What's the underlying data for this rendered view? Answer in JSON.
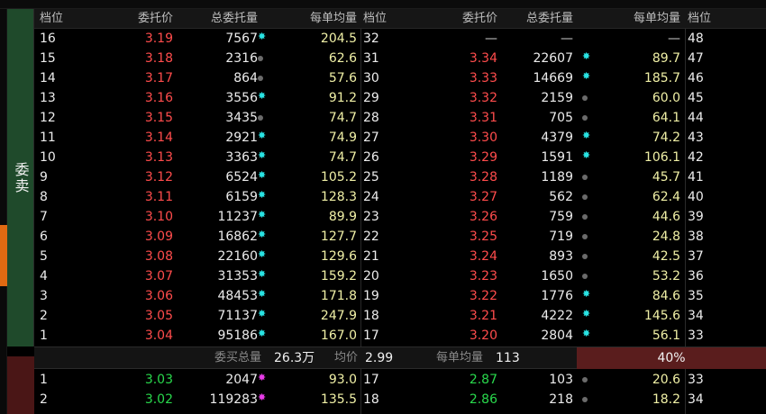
{
  "side": {
    "sell_label": "委卖"
  },
  "headers": [
    "档位",
    "委托价",
    "总委托量",
    "每单均量",
    "档位",
    "委托价",
    "总委托量",
    "每单均量",
    "档位"
  ],
  "sell_rows": [
    {
      "l": {
        "lv": "16",
        "px": "3.19",
        "vol": "7567",
        "m": "star",
        "avg": "204.5"
      },
      "r": {
        "lv": "32",
        "px": "—",
        "vol": "—",
        "m": "none",
        "avg": "—"
      },
      "e": "48"
    },
    {
      "l": {
        "lv": "15",
        "px": "3.18",
        "vol": "2316",
        "m": "dot",
        "avg": "62.6"
      },
      "r": {
        "lv": "31",
        "px": "3.34",
        "vol": "22607",
        "m": "star",
        "avg": "89.7"
      },
      "e": "47"
    },
    {
      "l": {
        "lv": "14",
        "px": "3.17",
        "vol": "864",
        "m": "dot",
        "avg": "57.6"
      },
      "r": {
        "lv": "30",
        "px": "3.33",
        "vol": "14669",
        "m": "star",
        "avg": "185.7"
      },
      "e": "46"
    },
    {
      "l": {
        "lv": "13",
        "px": "3.16",
        "vol": "3556",
        "m": "star",
        "avg": "91.2"
      },
      "r": {
        "lv": "29",
        "px": "3.32",
        "vol": "2159",
        "m": "dot",
        "avg": "60.0"
      },
      "e": "45"
    },
    {
      "l": {
        "lv": "12",
        "px": "3.15",
        "vol": "3435",
        "m": "dot",
        "avg": "74.7"
      },
      "r": {
        "lv": "28",
        "px": "3.31",
        "vol": "705",
        "m": "dot",
        "avg": "64.1"
      },
      "e": "44"
    },
    {
      "l": {
        "lv": "11",
        "px": "3.14",
        "vol": "2921",
        "m": "star",
        "avg": "74.9"
      },
      "r": {
        "lv": "27",
        "px": "3.30",
        "vol": "4379",
        "m": "star",
        "avg": "74.2"
      },
      "e": "43"
    },
    {
      "l": {
        "lv": "10",
        "px": "3.13",
        "vol": "3363",
        "m": "star",
        "avg": "74.7"
      },
      "r": {
        "lv": "26",
        "px": "3.29",
        "vol": "1591",
        "m": "star",
        "avg": "106.1"
      },
      "e": "42"
    },
    {
      "l": {
        "lv": "9",
        "px": "3.12",
        "vol": "6524",
        "m": "star",
        "avg": "105.2"
      },
      "r": {
        "lv": "25",
        "px": "3.28",
        "vol": "1189",
        "m": "dot",
        "avg": "45.7"
      },
      "e": "41"
    },
    {
      "l": {
        "lv": "8",
        "px": "3.11",
        "vol": "6159",
        "m": "star",
        "avg": "128.3"
      },
      "r": {
        "lv": "24",
        "px": "3.27",
        "vol": "562",
        "m": "dot",
        "avg": "62.4"
      },
      "e": "40"
    },
    {
      "l": {
        "lv": "7",
        "px": "3.10",
        "vol": "11237",
        "m": "star",
        "avg": "89.9"
      },
      "r": {
        "lv": "23",
        "px": "3.26",
        "vol": "759",
        "m": "dot",
        "avg": "44.6"
      },
      "e": "39"
    },
    {
      "l": {
        "lv": "6",
        "px": "3.09",
        "vol": "16862",
        "m": "star",
        "avg": "127.7"
      },
      "r": {
        "lv": "22",
        "px": "3.25",
        "vol": "719",
        "m": "dot",
        "avg": "24.8"
      },
      "e": "38"
    },
    {
      "l": {
        "lv": "5",
        "px": "3.08",
        "vol": "22160",
        "m": "star",
        "avg": "129.6"
      },
      "r": {
        "lv": "21",
        "px": "3.24",
        "vol": "893",
        "m": "dot",
        "avg": "42.5"
      },
      "e": "37"
    },
    {
      "l": {
        "lv": "4",
        "px": "3.07",
        "vol": "31353",
        "m": "star",
        "avg": "159.2"
      },
      "r": {
        "lv": "20",
        "px": "3.23",
        "vol": "1650",
        "m": "dot",
        "avg": "53.2"
      },
      "e": "36"
    },
    {
      "l": {
        "lv": "3",
        "px": "3.06",
        "vol": "48453",
        "m": "star",
        "avg": "171.8"
      },
      "r": {
        "lv": "19",
        "px": "3.22",
        "vol": "1776",
        "m": "star",
        "avg": "84.6"
      },
      "e": "35"
    },
    {
      "l": {
        "lv": "2",
        "px": "3.05",
        "vol": "71137",
        "m": "star",
        "avg": "247.9"
      },
      "r": {
        "lv": "18",
        "px": "3.21",
        "vol": "4222",
        "m": "star",
        "avg": "145.6"
      },
      "e": "34"
    },
    {
      "l": {
        "lv": "1",
        "px": "3.04",
        "vol": "95186",
        "m": "star",
        "avg": "167.0"
      },
      "r": {
        "lv": "17",
        "px": "3.20",
        "vol": "2804",
        "m": "star",
        "avg": "56.1"
      },
      "e": "33"
    }
  ],
  "summary": {
    "total_label": "委买总量",
    "total_value": "26.3万",
    "avg_price_label": "均价",
    "avg_price_value": "2.99",
    "avg_vol_label": "每单均量",
    "avg_vol_value": "113",
    "ratio": "40%"
  },
  "buy_rows": [
    {
      "l": {
        "lv": "1",
        "px": "3.03",
        "vol": "2047",
        "m": "magenta",
        "avg": "93.0"
      },
      "r": {
        "lv": "17",
        "px": "2.87",
        "vol": "103",
        "m": "dot",
        "avg": "20.6"
      },
      "e": "33"
    },
    {
      "l": {
        "lv": "2",
        "px": "3.02",
        "vol": "119283",
        "m": "magenta",
        "avg": "135.5"
      },
      "r": {
        "lv": "18",
        "px": "2.86",
        "vol": "218",
        "m": "dot",
        "avg": "18.2"
      },
      "e": "34"
    }
  ],
  "colors": {
    "sell_price": "#ff4c4c",
    "buy_price": "#29d84c",
    "avg": "#f0f0a6",
    "star_marker": "#29e3e3",
    "magenta_marker": "#e83ce8"
  }
}
